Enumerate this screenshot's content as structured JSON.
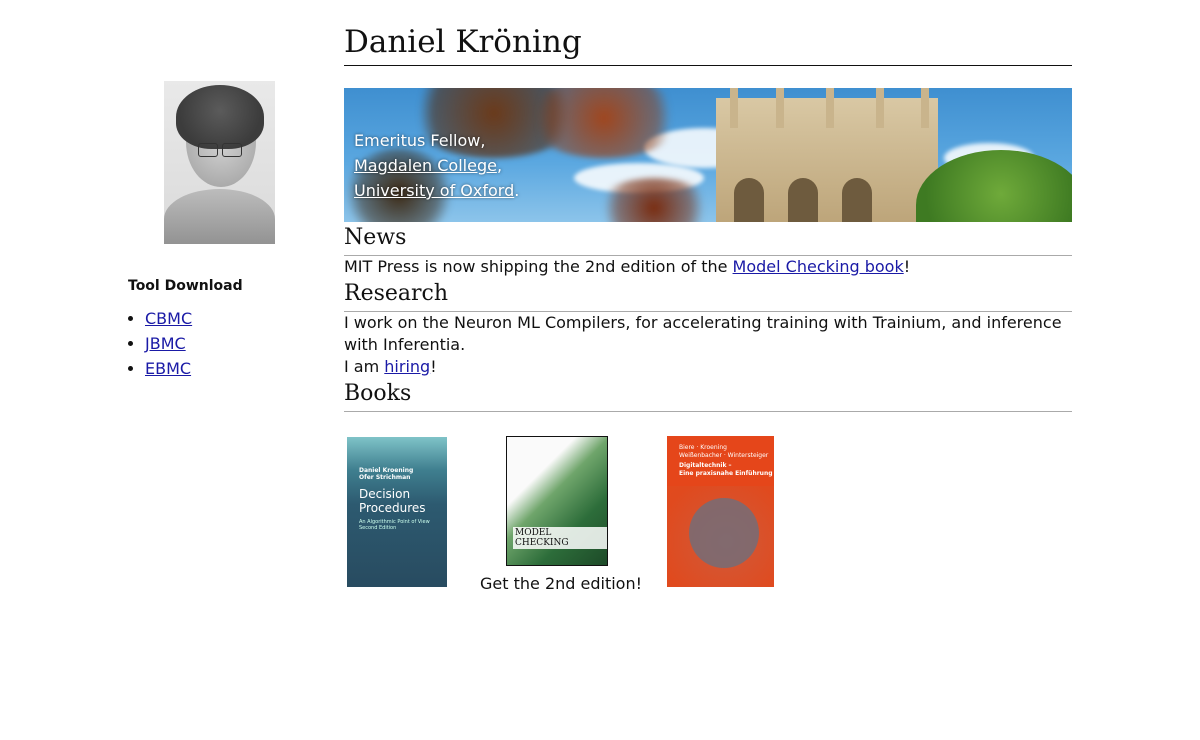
{
  "sidebar": {
    "heading": "Tool Download",
    "tools": [
      {
        "label": "CBMC"
      },
      {
        "label": "JBMC"
      },
      {
        "label": "EBMC"
      }
    ]
  },
  "main": {
    "title": "Daniel Kröning",
    "banner": {
      "line1": "Emeritus Fellow,",
      "college": "Magdalen College",
      "college_suffix": ",",
      "university": "University of Oxford",
      "university_suffix": "."
    },
    "news": {
      "heading": "News",
      "text_before": "MIT Press is now shipping the 2nd edition of the ",
      "link": "Model Checking book",
      "text_after": "!"
    },
    "research": {
      "heading": "Research",
      "text": "I work on the Neuron ML Compilers, for accelerating training with Trainium, and inference with Inferentia.",
      "hiring_before": "I am ",
      "hiring_link": "hiring",
      "hiring_after": "!"
    },
    "books": {
      "heading": "Books",
      "items": [
        {
          "authors": "Daniel Kroening\nOfer Strichman",
          "title": "Decision Procedures",
          "subtitle": "An Algorithmic Point of View\nSecond Edition"
        },
        {
          "title": "MODEL CHECKING"
        },
        {
          "authors": "Biere · Kroening\nWeißenbacher · Wintersteiger",
          "title": "Digitaltechnik –\nEine praxisnahe Einführung"
        }
      ],
      "caption": "Get the 2nd edition!"
    }
  },
  "colors": {
    "link": "#1a1aa6",
    "text": "#111111"
  }
}
